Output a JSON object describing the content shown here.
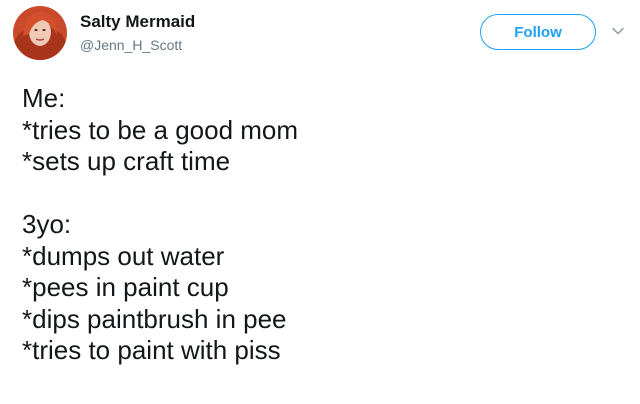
{
  "user": {
    "display_name": "Salty Mermaid",
    "handle": "@Jenn_H_Scott",
    "avatar": "profile-photo"
  },
  "follow_label": "Follow",
  "menu_icon": "chevron-down-icon",
  "tweet": {
    "lines_a": [
      "Me:",
      "*tries to be a good mom",
      "*sets up craft time"
    ],
    "lines_b": [
      "3yo:",
      "*dumps out water",
      "*pees in paint cup",
      "*dips paintbrush in pee",
      "*tries to paint with piss"
    ]
  },
  "colors": {
    "accent": "#1da1f2",
    "text": "#14171a",
    "secondary": "#657786"
  }
}
